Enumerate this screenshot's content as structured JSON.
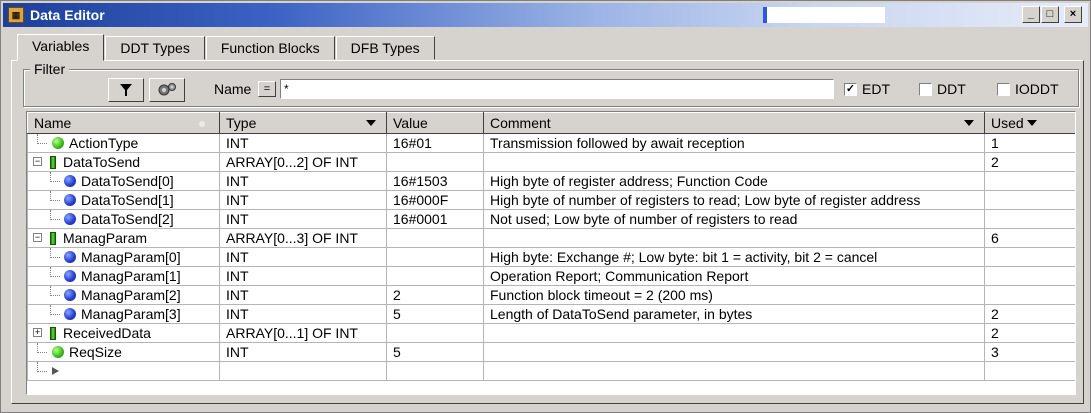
{
  "window": {
    "title": "Data Editor",
    "app_icon": "data-editor-app-icon"
  },
  "window_buttons": [
    "minimize-icon",
    "maximize-icon",
    "close-icon"
  ],
  "tabs": [
    {
      "label": "Variables",
      "active": true
    },
    {
      "label": "DDT Types",
      "active": false
    },
    {
      "label": "Function Blocks",
      "active": false
    },
    {
      "label": "DFB Types",
      "active": false
    }
  ],
  "filter": {
    "legend": "Filter",
    "name_label": "Name",
    "eq_label": "=",
    "name_value": "*",
    "checkboxes": [
      {
        "label": "EDT",
        "checked": true
      },
      {
        "label": "DDT",
        "checked": false
      },
      {
        "label": "IODDT",
        "checked": false
      }
    ]
  },
  "columns": {
    "name": "Name",
    "type": "Type",
    "value": "Value",
    "comment": "Comment",
    "used": "Used"
  },
  "rows": [
    {
      "name": "ActionType",
      "level": 0,
      "icon": "green-ball",
      "expander": "",
      "type": "INT",
      "value": "16#01",
      "comment": "Transmission followed by await reception",
      "used": "1"
    },
    {
      "name": "DataToSend",
      "level": 0,
      "icon": "green-bar",
      "expander": "−",
      "type": "ARRAY[0...2] OF INT",
      "value": "",
      "comment": "",
      "used": "2"
    },
    {
      "name": "DataToSend[0]",
      "level": 1,
      "icon": "blue-ball",
      "expander": "",
      "type": "INT",
      "value": "16#1503",
      "comment": "High byte of register address; Function Code",
      "used": ""
    },
    {
      "name": "DataToSend[1]",
      "level": 1,
      "icon": "blue-ball",
      "expander": "",
      "type": "INT",
      "value": "16#000F",
      "comment": "High byte of number of registers to read; Low byte of register address",
      "used": ""
    },
    {
      "name": "DataToSend[2]",
      "level": 1,
      "icon": "blue-ball",
      "expander": "",
      "type": "INT",
      "value": "16#0001",
      "comment": "Not used; Low byte of number of registers to read",
      "used": ""
    },
    {
      "name": "ManagParam",
      "level": 0,
      "icon": "green-bar",
      "expander": "−",
      "type": "ARRAY[0...3] OF INT",
      "value": "",
      "comment": "",
      "used": "6"
    },
    {
      "name": "ManagParam[0]",
      "level": 1,
      "icon": "blue-ball",
      "expander": "",
      "type": "INT",
      "value": "",
      "comment": "High byte: Exchange #; Low byte: bit 1 = activity, bit 2 = cancel",
      "used": ""
    },
    {
      "name": "ManagParam[1]",
      "level": 1,
      "icon": "blue-ball",
      "expander": "",
      "type": "INT",
      "value": "",
      "comment": "Operation Report; Communication Report",
      "used": ""
    },
    {
      "name": "ManagParam[2]",
      "level": 1,
      "icon": "blue-ball",
      "expander": "",
      "type": "INT",
      "value": "2",
      "comment": "Function block timeout = 2 (200 ms)",
      "used": ""
    },
    {
      "name": "ManagParam[3]",
      "level": 1,
      "icon": "blue-ball",
      "expander": "",
      "type": "INT",
      "value": "5",
      "comment": "Length of DataToSend parameter, in bytes",
      "used": "2"
    },
    {
      "name": "ReceivedData",
      "level": 0,
      "icon": "green-bar",
      "expander": "+",
      "type": "ARRAY[0...1] OF INT",
      "value": "",
      "comment": "",
      "used": "2"
    },
    {
      "name": "ReqSize",
      "level": 0,
      "icon": "green-ball",
      "expander": "",
      "type": "INT",
      "value": "5",
      "comment": "",
      "used": "3"
    },
    {
      "name": "",
      "level": 0,
      "icon": "arrow",
      "expander": "",
      "type": "",
      "value": "",
      "comment": "",
      "used": ""
    }
  ]
}
